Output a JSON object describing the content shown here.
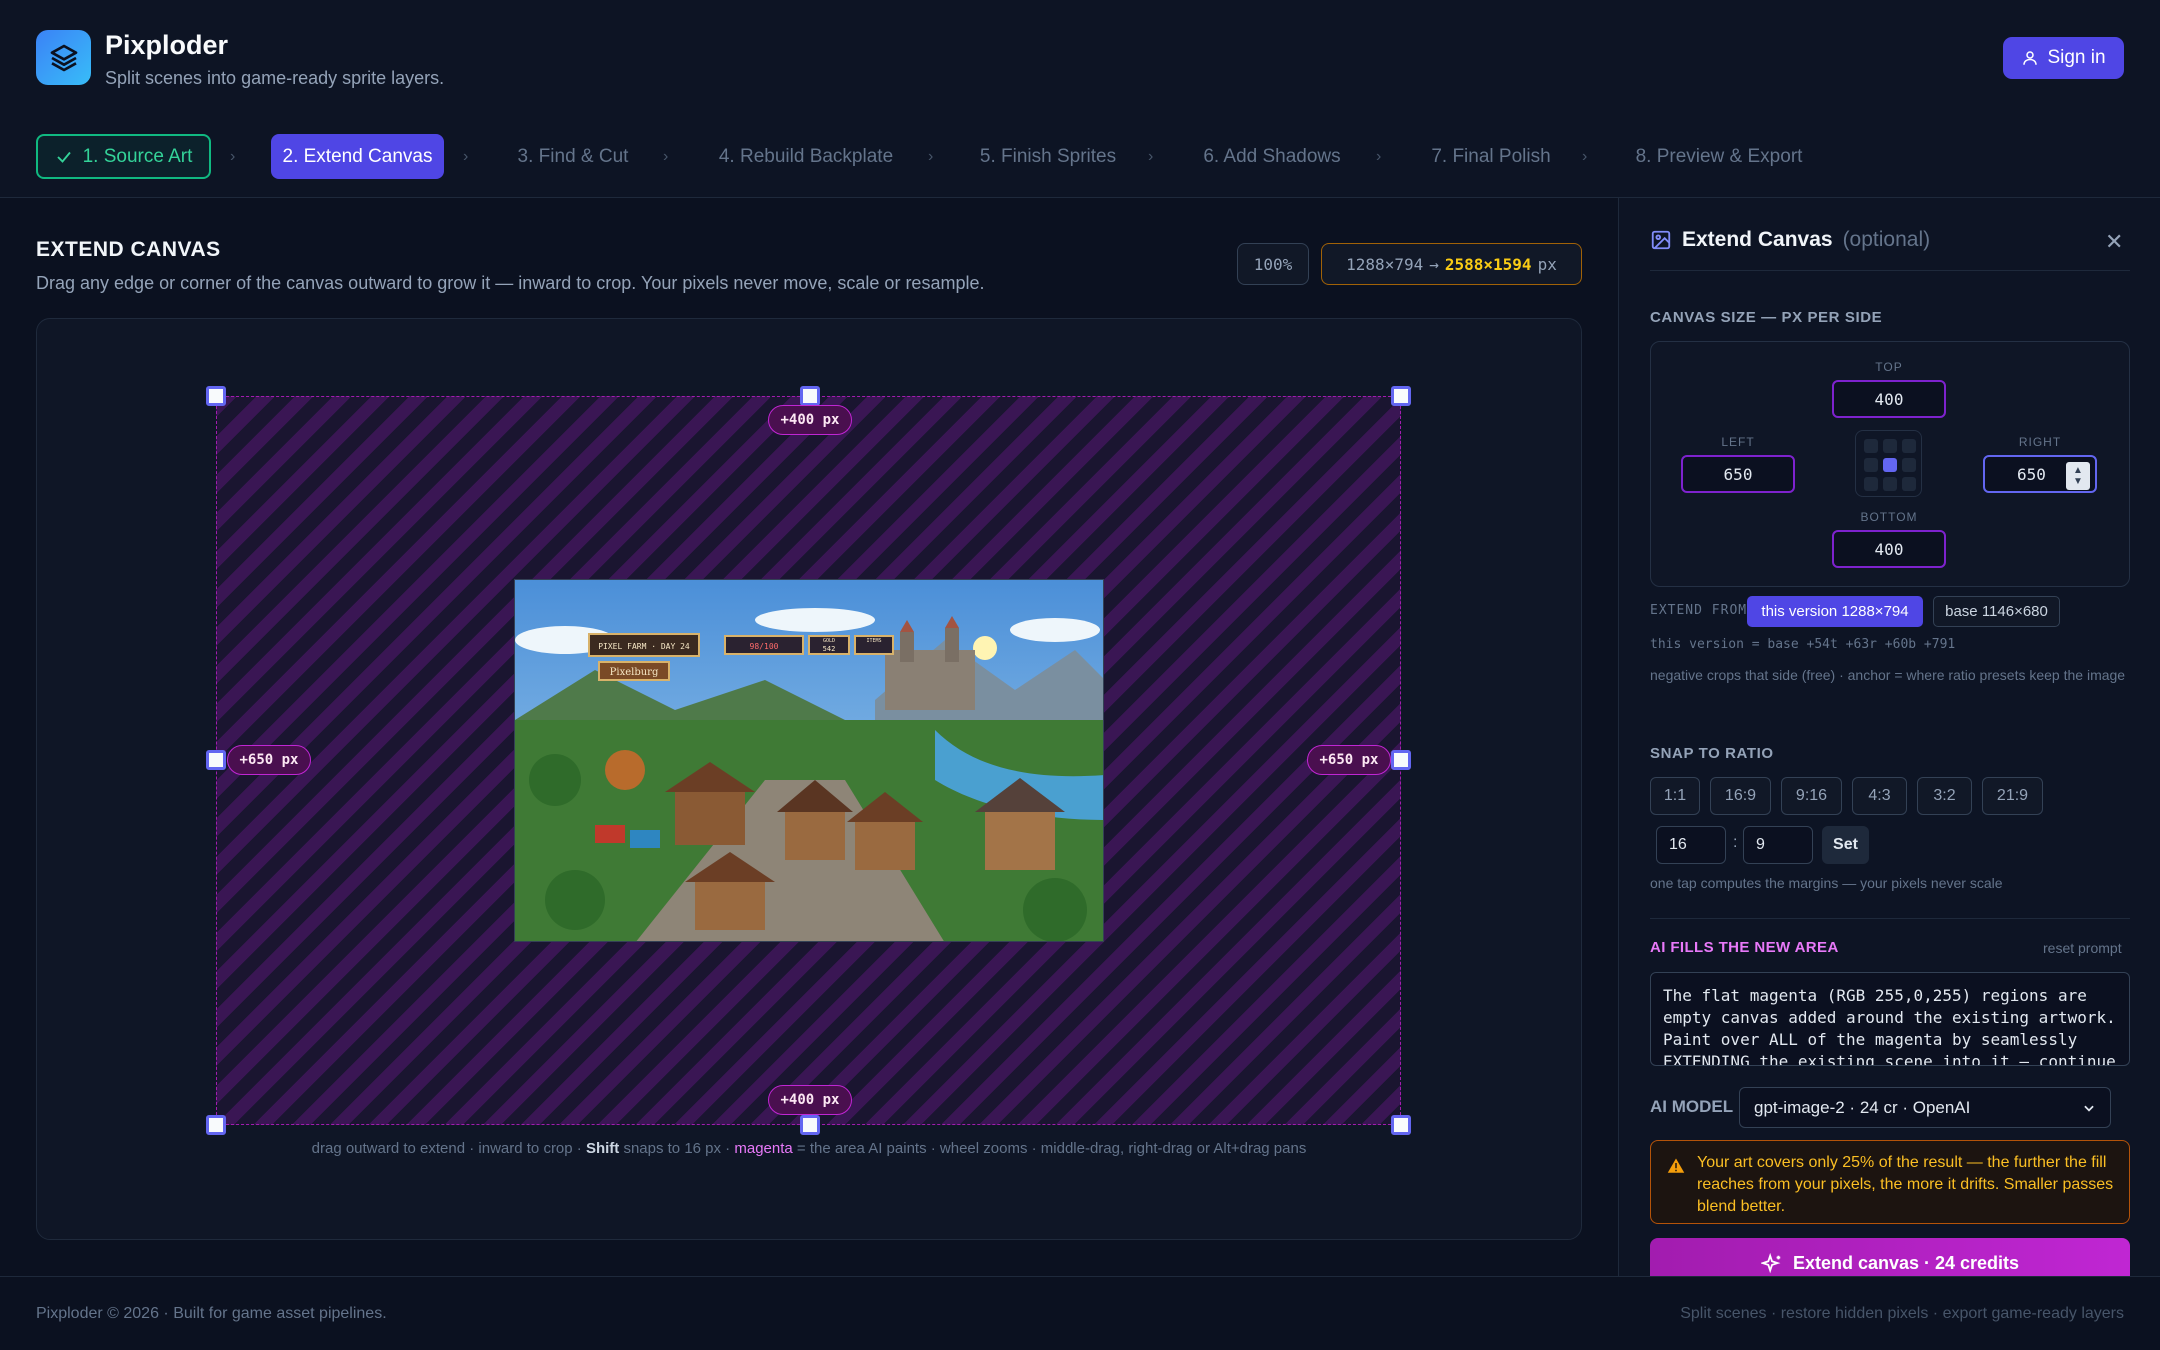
{
  "app": {
    "title": "Pixploder",
    "subtitle": "Split scenes into game-ready sprite layers.",
    "sign_in": "Sign in"
  },
  "steps": [
    {
      "label": "1. Source Art",
      "state": "done"
    },
    {
      "label": "2. Extend Canvas",
      "state": "active"
    },
    {
      "label": "3. Find & Cut",
      "state": "pending"
    },
    {
      "label": "4. Rebuild Backplate",
      "state": "pending"
    },
    {
      "label": "5. Finish Sprites",
      "state": "pending"
    },
    {
      "label": "6. Add Shadows",
      "state": "pending"
    },
    {
      "label": "7. Final Polish",
      "state": "pending"
    },
    {
      "label": "8. Preview & Export",
      "state": "pending"
    }
  ],
  "main": {
    "title": "EXTEND CANVAS",
    "description": "Drag any edge or corner of the canvas outward to grow it — inward to crop. Your pixels never move, scale or resample.",
    "zoom": "100%",
    "size_from": "1288×794",
    "arrow": "→",
    "size_to": "2588×1594",
    "size_unit": "px",
    "labels": {
      "top": "+400 px",
      "bottom": "+400 px",
      "left": "+650 px",
      "right": "+650 px"
    },
    "art": {
      "hud_name": "PIXEL FARM · DAY 24",
      "hud_hp": "98/100",
      "hud_gold_label": "GOLD",
      "hud_gold": "542",
      "hud_items": "ITEMS",
      "sign": "Pixelburg"
    },
    "hint_1": "drag outward to extend · inward to crop · ",
    "hint_shift": "Shift",
    "hint_2": " snaps to 16 px · ",
    "hint_magenta": "magenta",
    "hint_3": " = the area AI paints · wheel zooms · middle-drag, right-drag or Alt+drag pans"
  },
  "panel": {
    "title": "Extend Canvas",
    "optional": "(optional)",
    "canvas_size_label": "CANVAS SIZE — PX PER SIDE",
    "top_label": "TOP",
    "top": "400",
    "left_label": "LEFT",
    "left": "650",
    "right_label": "RIGHT",
    "right": "650",
    "bottom_label": "BOTTOM",
    "bottom": "400",
    "extend_from_label": "EXTEND FROM",
    "extend_this": "this version 1288×794",
    "extend_base": "base 1146×680",
    "version_note": "this version = base +54t +63r +60b +791",
    "crop_note": "negative crops that side (free) · anchor = where ratio presets keep the image",
    "snap_label": "SNAP TO RATIO",
    "ratios": [
      "1:1",
      "16:9",
      "9:16",
      "4:3",
      "3:2",
      "21:9"
    ],
    "ratio_w": "16",
    "ratio_sep": ":",
    "ratio_h": "9",
    "set": "Set",
    "snap_note": "one tap computes the margins — your pixels never scale",
    "ai_title": "AI FILLS THE NEW AREA",
    "reset": "reset prompt",
    "prompt": "The flat magenta (RGB 255,0,255) regions are empty canvas added around the existing artwork. Paint over ALL of the magenta by seamlessly EXTENDING the existing scene into it — continue",
    "model_label": "AI MODEL",
    "model": "gpt-image-2 · 24 cr · OpenAI",
    "warning": "Your art covers only 25% of the result — the further the fill reaches from your pixels, the more it drifts. Smaller passes blend better.",
    "cta": "Extend canvas · 24 credits"
  },
  "footer": {
    "left": "Pixploder © 2026 · Built for game asset pipelines.",
    "right": "Split scenes · restore hidden pixels · export game-ready layers"
  }
}
